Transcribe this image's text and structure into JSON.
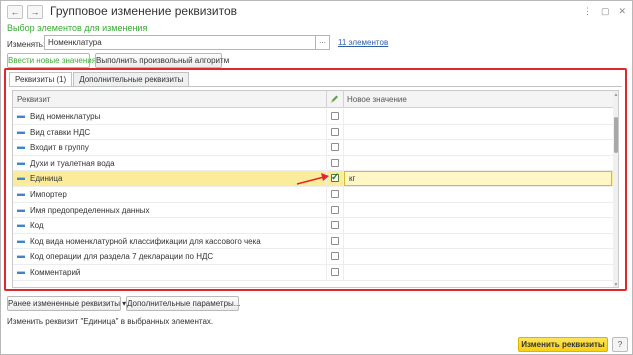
{
  "window": {
    "title": "Групповое изменение реквизитов",
    "back_icon": "arrow-left-icon",
    "forward_icon": "arrow-right-icon",
    "window_icons": [
      "more-vertical-icon",
      "restore-icon",
      "close-icon"
    ]
  },
  "subtitle": "Выбор элементов для изменения",
  "change_field": {
    "label": "Изменять:",
    "value": "Номенклатура",
    "dots": "...",
    "link": "11 элементов"
  },
  "mode_buttons": {
    "new_values": "Ввести новые значения",
    "custom_algorithm": "Выполнить произвольный алгоритм"
  },
  "tabs": [
    {
      "label": "Реквизиты (1)",
      "active": true
    },
    {
      "label": "Дополнительные реквизиты",
      "active": false
    }
  ],
  "grid": {
    "columns": {
      "attribute": "Реквизит",
      "edit_icon": "pencil-icon",
      "new_value": "Новое значение"
    },
    "rows": [
      {
        "name": "Вид номенклатуры",
        "checked": false,
        "value": ""
      },
      {
        "name": "Вид ставки НДС",
        "checked": false,
        "value": ""
      },
      {
        "name": "Входит в группу",
        "checked": false,
        "value": ""
      },
      {
        "name": "Духи и туалетная вода",
        "checked": false,
        "value": ""
      },
      {
        "name": "Единица",
        "checked": true,
        "value": "кг"
      },
      {
        "name": "Импортер",
        "checked": false,
        "value": ""
      },
      {
        "name": "Имя предопределенных данных",
        "checked": false,
        "value": ""
      },
      {
        "name": "Код",
        "checked": false,
        "value": ""
      },
      {
        "name": "Код вида номенклатурной классификации для кассового чека",
        "checked": false,
        "value": ""
      },
      {
        "name": "Код операции для раздела 7 декларации по НДС",
        "checked": false,
        "value": ""
      },
      {
        "name": "Комментарий",
        "checked": false,
        "value": ""
      }
    ]
  },
  "bottom_buttons": {
    "previous": "Ранее измененные реквизиты",
    "previous_caret": "▾",
    "additional": "Дополнительные параметры..."
  },
  "status_text": "Изменить реквизит \"Единица\" в выбранных элементах.",
  "apply_button": "Изменить реквизиты",
  "help_button": "?",
  "colors": {
    "accent_green": "#3aaa35",
    "highlight_frame": "#e12727",
    "selected_row": "#fbec9c",
    "apply_button": "#f7cf15",
    "link": "#2c5ea8"
  }
}
